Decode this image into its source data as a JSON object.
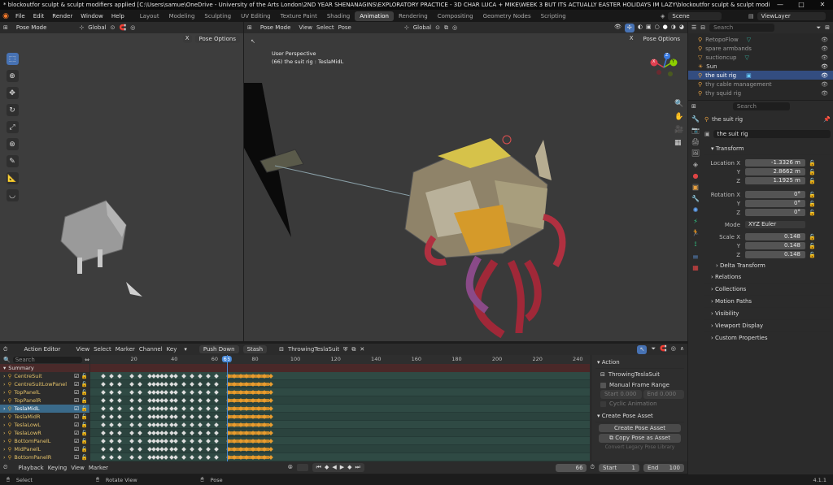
{
  "window": {
    "title": "* blockoutfor sculpt & sculpt modifiers applied [C:\\Users\\samue\\OneDrive - University of the Arts London\\2ND YEAR SHENANAGINS\\EXPLORATORY PRACTICE - 3D CHAR LUCA + MIKE\\WEEK 3 BUT ITS ACTUALLY EASTER HOLIDAYS IM LAZY\\blockoutfor sculpt & sculpt modifiers",
    "controls": [
      "—",
      "□",
      "✕"
    ]
  },
  "menu": [
    "File",
    "Edit",
    "Render",
    "Window",
    "Help"
  ],
  "workspace_tabs": [
    "Layout",
    "Modeling",
    "Sculpting",
    "UV Editing",
    "Texture Paint",
    "Shading",
    "Animation",
    "Rendering",
    "Compositing",
    "Geometry Nodes",
    "Scripting"
  ],
  "active_tab": "Animation",
  "scene": {
    "scene_label": "Scene",
    "view_layer_label": "ViewLayer"
  },
  "left_viewport": {
    "mode": "Pose Mode",
    "orientation": "Global",
    "pose_options": "Pose Options"
  },
  "main_viewport": {
    "mode": "Pose Mode",
    "menu": [
      "View",
      "Select",
      "Pose"
    ],
    "orientation": "Global",
    "pose_options": "Pose Options",
    "info_line1": "User Perspective",
    "info_line2": "(66) the suit rig : TeslaMidL",
    "gizmo": {
      "x": "X",
      "y": "Y",
      "z": "Z"
    }
  },
  "outliner": {
    "search_placeholder": "Search",
    "items": [
      {
        "name": "RetopoFlow",
        "selected": false
      },
      {
        "name": "spare armbands",
        "selected": false
      },
      {
        "name": "suctioncup",
        "selected": false
      },
      {
        "name": "Sun",
        "selected": false
      },
      {
        "name": "the suit rig",
        "selected": true
      },
      {
        "name": "thy cable management",
        "selected": false
      },
      {
        "name": "thy squid rig",
        "selected": false
      }
    ]
  },
  "properties": {
    "search_placeholder": "Search",
    "breadcrumb": "the suit rig",
    "object_name": "the suit rig",
    "transform_title": "Transform",
    "location": {
      "label": "Location X",
      "x": "-1.3326 m",
      "y": "2.8662 m",
      "z": "1.1925 m"
    },
    "rotation": {
      "label": "Rotation X",
      "x": "0°",
      "y": "0°",
      "z": "0°"
    },
    "mode_label": "Mode",
    "mode_value": "XYZ Euler",
    "scale": {
      "label": "Scale X",
      "x": "0.148",
      "y": "0.148",
      "z": "0.148"
    },
    "axis_y": "Y",
    "axis_z": "Z",
    "delta": "Delta Transform",
    "panels": [
      "Relations",
      "Collections",
      "Motion Paths",
      "Visibility",
      "Viewport Display",
      "Custom Properties"
    ]
  },
  "action_editor": {
    "editor": "Action Editor",
    "menu": [
      "View",
      "Select",
      "Marker",
      "Channel",
      "Key"
    ],
    "push_down": "Push Down",
    "stash": "Stash",
    "action_name": "ThrowingTeslaSuit",
    "search_placeholder": "Search",
    "summary": "Summary",
    "channels": [
      "CentreSuit",
      "CentreSuitLowPanel",
      "TopPanelL",
      "TopPanelR",
      "TeslaMidL",
      "TeslaMidR",
      "TeslaLowL",
      "TeslaLowR",
      "BottomPanelL",
      "MidPanelL",
      "BottomPanelR"
    ],
    "selected_channel": "TeslaMidL",
    "ruler": [
      20,
      40,
      60,
      66,
      80,
      100,
      120,
      140,
      160,
      180,
      200,
      220,
      240
    ],
    "current_frame": 66
  },
  "action_sidebar": {
    "section": "Action",
    "action_name": "ThrowingTeslaSuit",
    "manual_frame_range": "Manual Frame Range",
    "start_label": "Start",
    "start_value": "0.000",
    "end_label": "End",
    "end_value": "0.000",
    "cyclic": "Cyclic Animation",
    "pose_asset_section": "Create Pose Asset",
    "create_pose_asset": "Create Pose Asset",
    "copy_pose": "Copy Pose as Asset",
    "convert_legacy": "Convert Legacy Pose Library"
  },
  "timeline": {
    "menu": [
      "Playback",
      "Keying",
      "View",
      "Marker"
    ],
    "frame": "66",
    "start_label": "Start",
    "start": "1",
    "end_label": "End",
    "end": "100"
  },
  "statusbar": {
    "select": "Select",
    "rotate": "Rotate View",
    "pose": "Pose",
    "version": "4.1.1"
  }
}
